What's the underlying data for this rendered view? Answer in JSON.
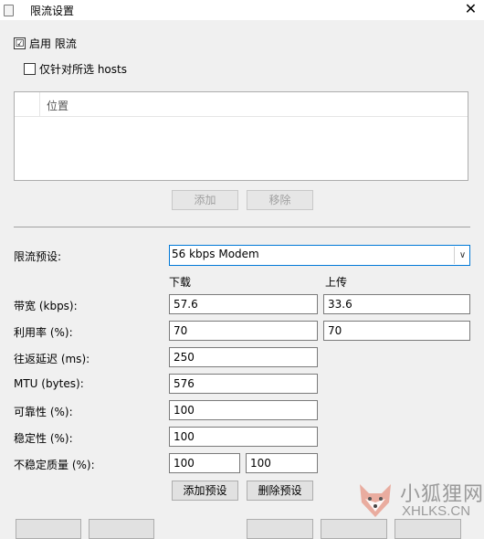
{
  "window": {
    "title": "限流设置"
  },
  "enable": {
    "checked": "☑",
    "label": "启用 限流"
  },
  "hosts_only": {
    "checked": "",
    "label": "仅针对所选 hosts"
  },
  "hosts_table": {
    "columns": [
      "位置"
    ]
  },
  "hosts_buttons": {
    "add": "添加",
    "remove": "移除"
  },
  "preset": {
    "label": "限流预设:",
    "value": "56 kbps Modem"
  },
  "headers": {
    "down": "下载",
    "up": "上传"
  },
  "fields": {
    "bandwidth": {
      "label": "带宽 (kbps):",
      "down": "57.6",
      "up": "33.6"
    },
    "utilization": {
      "label": "利用率 (%):",
      "down": "70",
      "up": "70"
    },
    "rtt": {
      "label": "往返延迟 (ms):",
      "value": "250"
    },
    "mtu": {
      "label": "MTU (bytes):",
      "value": "576"
    },
    "reliability": {
      "label": "可靠性 (%):",
      "value": "100"
    },
    "stability": {
      "label": "稳定性 (%):",
      "value": "100"
    },
    "unstable_quality": {
      "label": "不稳定质量 (%):",
      "value1": "100",
      "value2": "100"
    }
  },
  "preset_buttons": {
    "add": "添加预设",
    "delete": "删除预设"
  },
  "watermark": {
    "cn": "小狐狸网",
    "en": "XHLKS.CN"
  },
  "colors": {
    "focus": "#0078d7",
    "border": "#adadad",
    "background": "#f0f0f0"
  }
}
